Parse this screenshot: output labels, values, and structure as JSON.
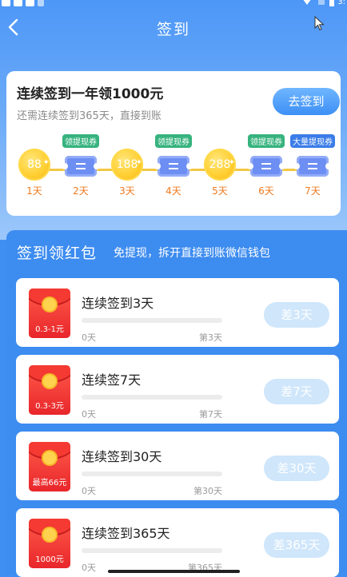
{
  "header": {
    "title": "签到",
    "back_icon": "chevron-left-icon",
    "accent": "#4d97f7"
  },
  "status_bar": {
    "time": "3:"
  },
  "checkin_card": {
    "title": "连续签到一年领1000元",
    "subtitle": "还需连续签到365天，直接到账",
    "button_label": "去签到",
    "days": [
      {
        "type": "coin",
        "value": "88",
        "label": "1天",
        "tag": ""
      },
      {
        "type": "ticket",
        "value": "",
        "label": "2天",
        "tag": "领提现券"
      },
      {
        "type": "coin",
        "value": "188",
        "label": "3天",
        "tag": ""
      },
      {
        "type": "ticket",
        "value": "",
        "label": "4天",
        "tag": "领提现券"
      },
      {
        "type": "coin",
        "value": "288",
        "label": "5天",
        "tag": ""
      },
      {
        "type": "ticket",
        "value": "",
        "label": "6天",
        "tag": "领提现券"
      },
      {
        "type": "ticket",
        "value": "",
        "label": "7天",
        "tag": "大量提现券"
      }
    ]
  },
  "redpacket_panel": {
    "title": "签到领红包",
    "subtitle": "免提现，拆开直接到账微信钱包",
    "items": [
      {
        "title": "连续签到3天",
        "amount": "0.3-1元",
        "progress": 0,
        "start": "0天",
        "end": "第3天",
        "button": "差3天"
      },
      {
        "title": "连续签7天",
        "amount": "0.3-3元",
        "progress": 0,
        "start": "0天",
        "end": "第7天",
        "button": "差7天"
      },
      {
        "title": "连续签到30天",
        "amount": "最高66元",
        "progress": 0,
        "start": "0天",
        "end": "第30天",
        "button": "差30天"
      },
      {
        "title": "连续签到365天",
        "amount": "1000元",
        "progress": 0,
        "start": "0天",
        "end": "第365天",
        "button": "差365天"
      }
    ]
  }
}
